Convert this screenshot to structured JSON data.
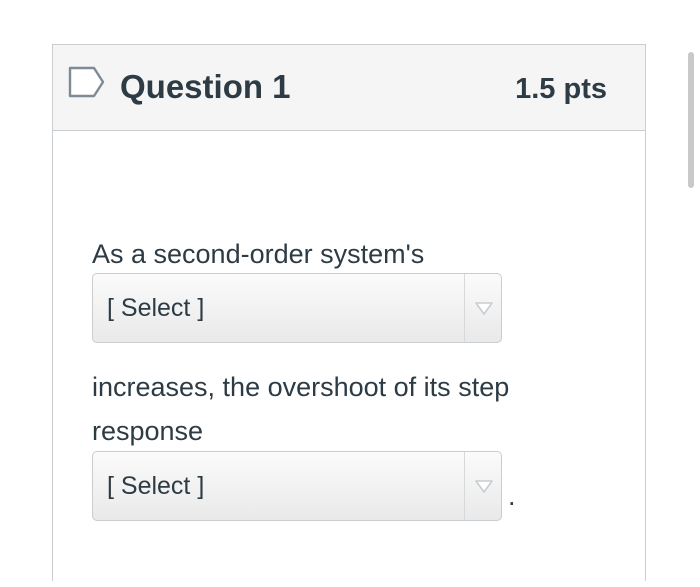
{
  "question": {
    "title": "Question 1",
    "points": "1.5 pts"
  },
  "body": {
    "text_line_1": "As a second-order system's",
    "select_1": {
      "value": "[ Select ]"
    },
    "text_line_2": "increases, the overshoot of its step",
    "text_line_3": "response",
    "select_2": {
      "value": "[ Select ]"
    },
    "trailing_punctuation": "."
  },
  "colors": {
    "border": "#c7cdd1",
    "header_bg": "#f5f5f5",
    "text": "#2d3b45",
    "select_arrow": "#c7cdd1"
  },
  "icons": {
    "flag": "flag-outline-icon",
    "dropdown": "chevron-down-icon"
  }
}
